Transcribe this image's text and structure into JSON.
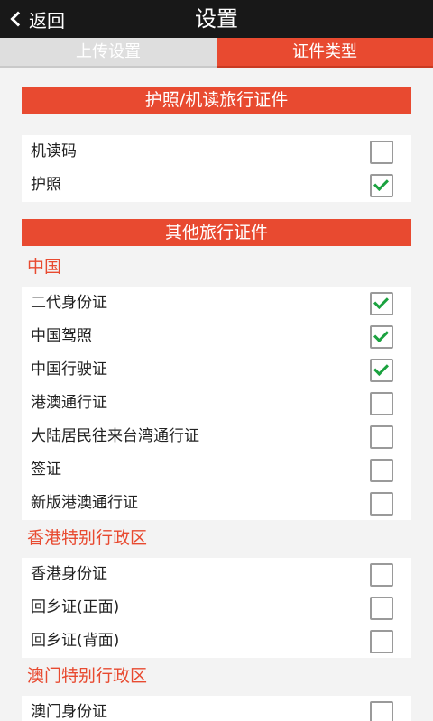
{
  "titlebar": {
    "back_label": "返回",
    "title": "设置"
  },
  "tabs": {
    "upload_label": "上传设置",
    "doc_type_label": "证件类型",
    "active": "证件类型"
  },
  "colors": {
    "accent": "#e84a30",
    "check": "#1aa23f",
    "titlebar": "#181818"
  },
  "sections": {
    "passport": {
      "title": "护照/机读旅行证件",
      "items": [
        {
          "label": "机读码",
          "checked": false
        },
        {
          "label": "护照",
          "checked": true
        }
      ]
    },
    "other": {
      "title": "其他旅行证件",
      "groups": {
        "china": {
          "label": "中国",
          "items": [
            {
              "label": "二代身份证",
              "checked": true
            },
            {
              "label": "中国驾照",
              "checked": true
            },
            {
              "label": "中国行驶证",
              "checked": true
            },
            {
              "label": "港澳通行证",
              "checked": false
            },
            {
              "label": "大陆居民往来台湾通行证",
              "checked": false
            },
            {
              "label": "签证",
              "checked": false
            },
            {
              "label": "新版港澳通行证",
              "checked": false
            }
          ]
        },
        "hk": {
          "label": "香港特别行政区",
          "items": [
            {
              "label": "香港身份证",
              "checked": false
            },
            {
              "label": "回乡证(正面)",
              "checked": false
            },
            {
              "label": "回乡证(背面)",
              "checked": false
            }
          ]
        },
        "macau": {
          "label": "澳门特别行政区",
          "items": [
            {
              "label": "澳门身份证",
              "checked": false
            }
          ]
        }
      }
    }
  }
}
